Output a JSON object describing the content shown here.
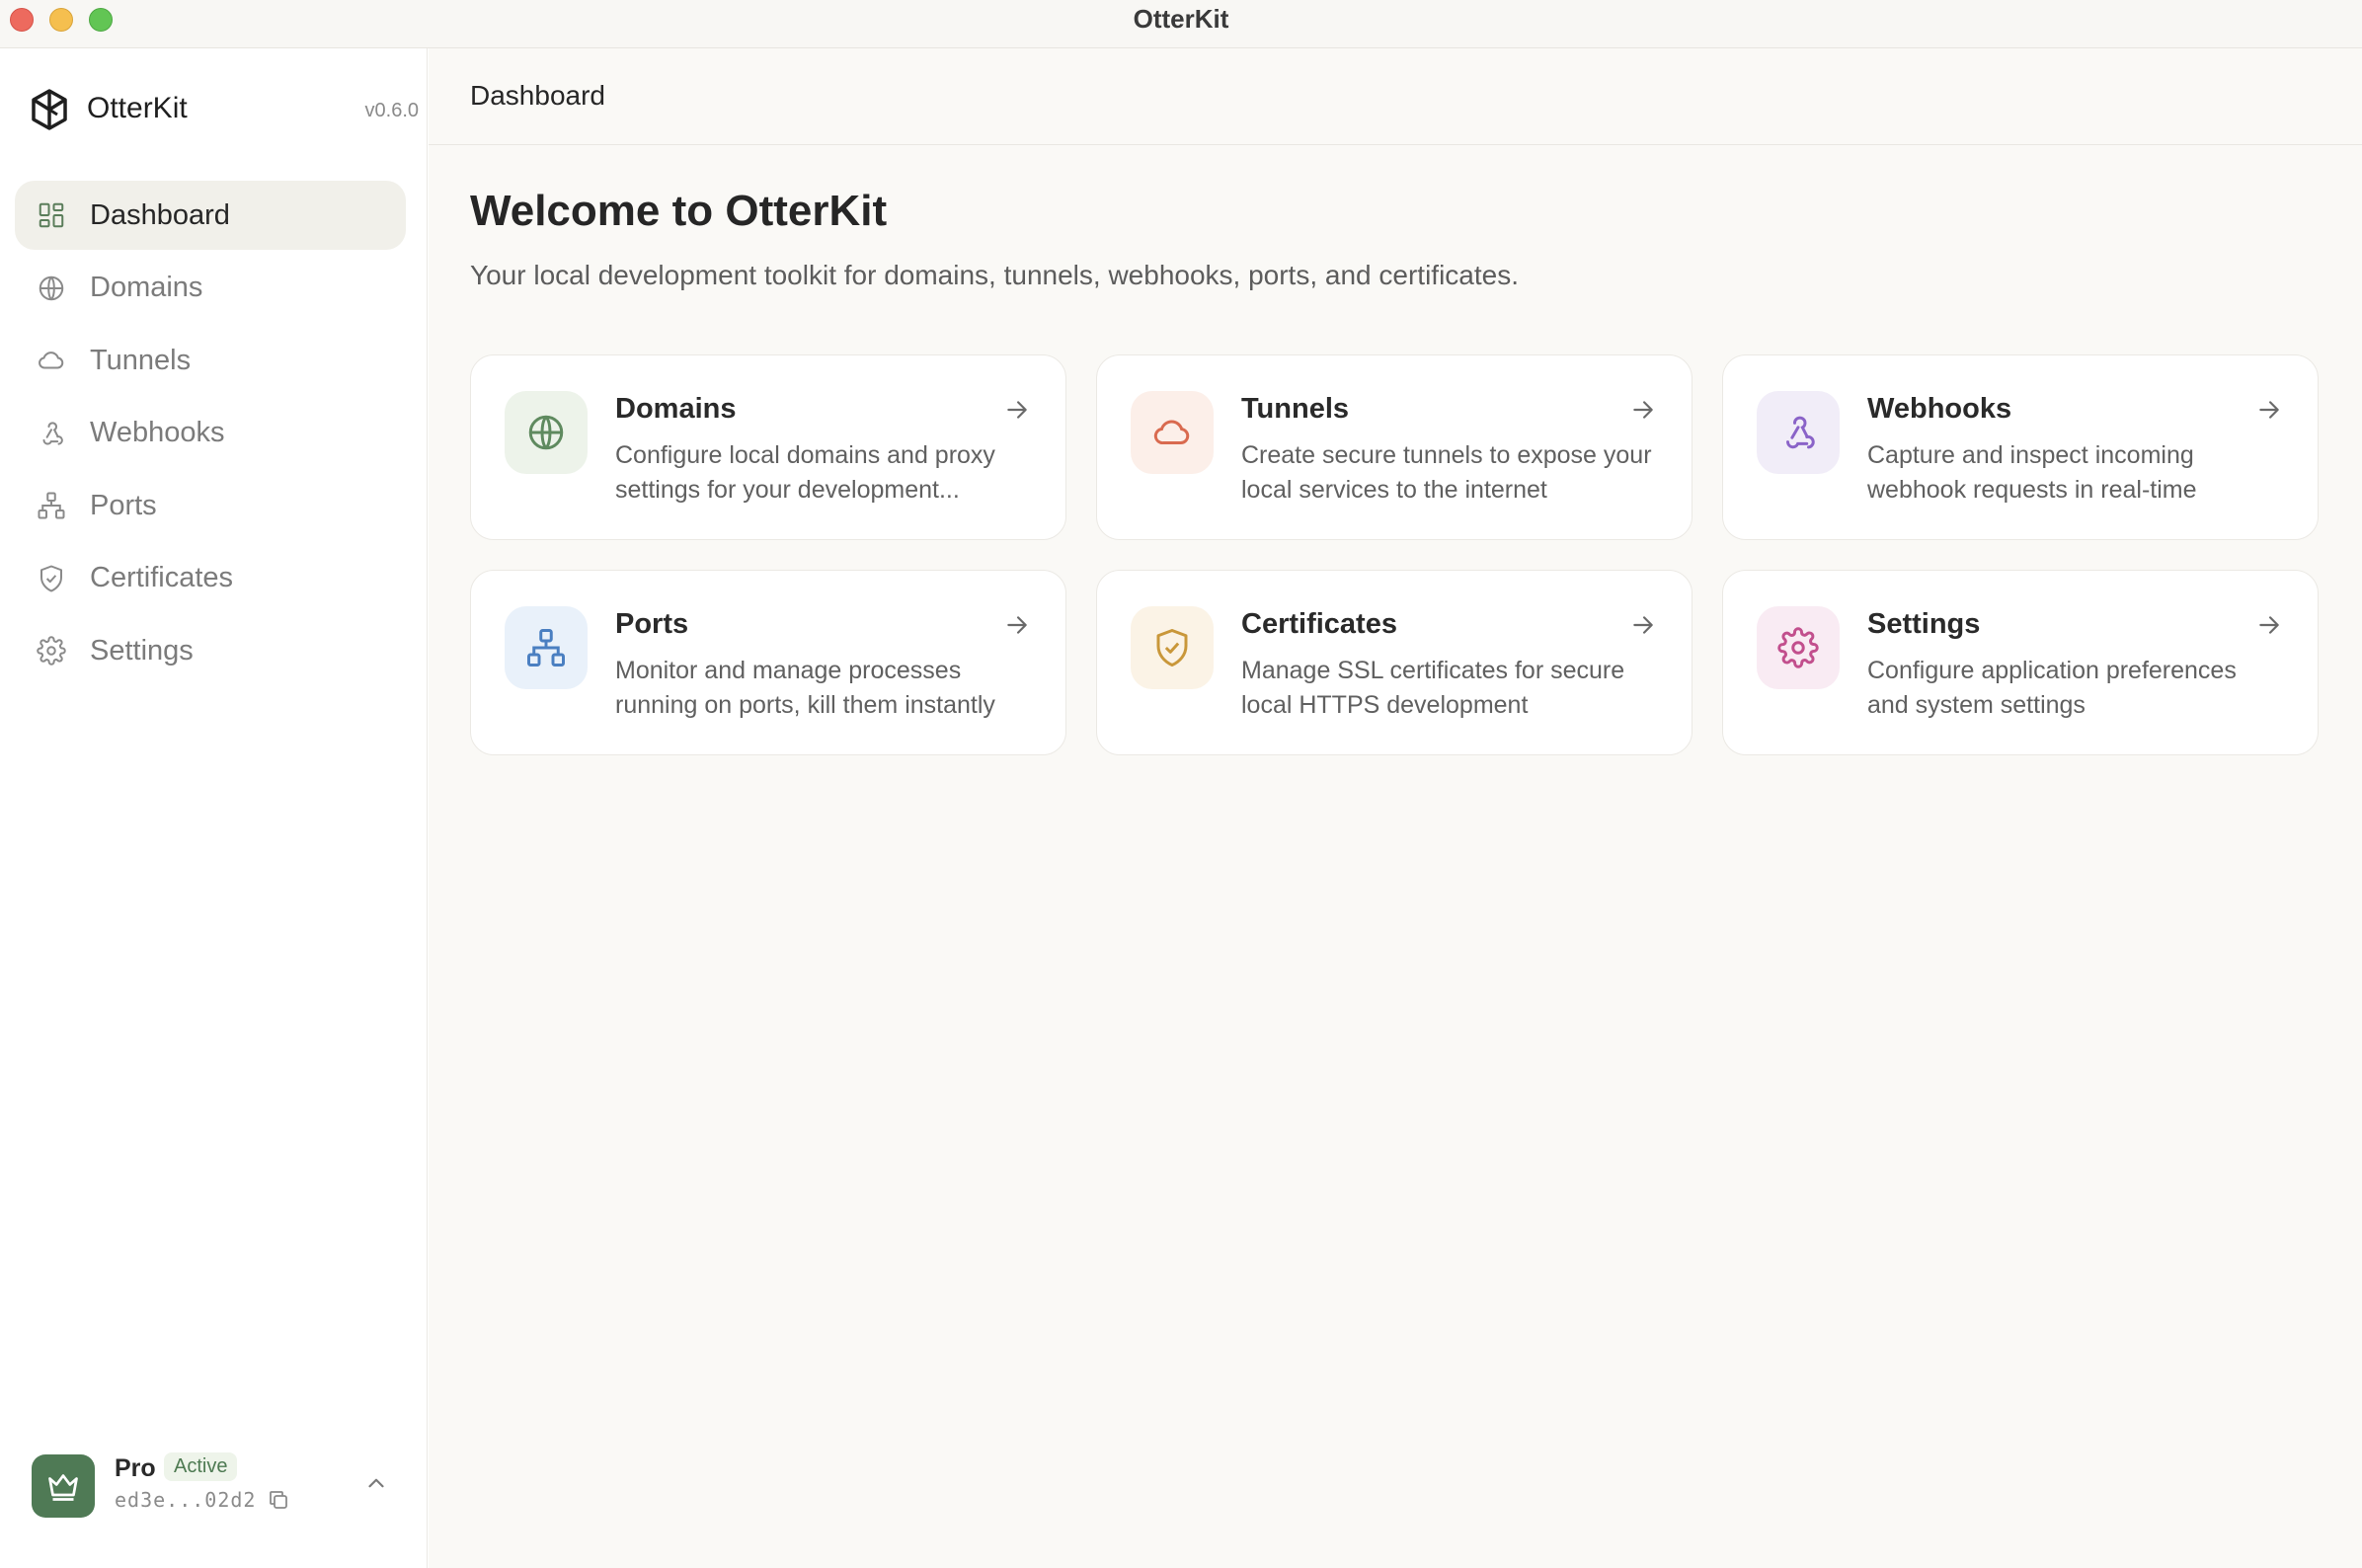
{
  "window": {
    "title": "OtterKit"
  },
  "sidebar": {
    "brand": {
      "name": "OtterKit",
      "version": "v0.6.0"
    },
    "items": [
      {
        "label": "Dashboard",
        "icon": "dashboard-icon",
        "active": true
      },
      {
        "label": "Domains",
        "icon": "globe-icon",
        "active": false
      },
      {
        "label": "Tunnels",
        "icon": "cloud-icon",
        "active": false
      },
      {
        "label": "Webhooks",
        "icon": "webhook-icon",
        "active": false
      },
      {
        "label": "Ports",
        "icon": "network-icon",
        "active": false
      },
      {
        "label": "Certificates",
        "icon": "shield-icon",
        "active": false
      },
      {
        "label": "Settings",
        "icon": "gear-icon",
        "active": false
      }
    ],
    "account": {
      "plan": "Pro",
      "status": "Active",
      "key": "ed3e...02d2"
    }
  },
  "main": {
    "header_title": "Dashboard",
    "welcome_title": "Welcome to OtterKit",
    "welcome_subtitle": "Your local development toolkit for domains, tunnels, webhooks, ports, and certificates.",
    "cards": [
      {
        "title": "Domains",
        "description": "Configure local domains and proxy settings for your development...",
        "icon": "globe-icon",
        "accent": "#5f8a5f",
        "bg": "#edf3ea"
      },
      {
        "title": "Tunnels",
        "description": "Create secure tunnels to expose your local services to the internet",
        "icon": "cloud-icon",
        "accent": "#d96a4f",
        "bg": "#fcefe9"
      },
      {
        "title": "Webhooks",
        "description": "Capture and inspect incoming webhook requests in real-time",
        "icon": "webhook-icon",
        "accent": "#8a63c8",
        "bg": "#f1edf8"
      },
      {
        "title": "Ports",
        "description": "Monitor and manage processes running on ports, kill them instantly",
        "icon": "network-icon",
        "accent": "#4a7fc1",
        "bg": "#e9f1fa"
      },
      {
        "title": "Certificates",
        "description": "Manage SSL certificates for secure local HTTPS development",
        "icon": "shield-icon",
        "accent": "#c9973a",
        "bg": "#fbf3e6"
      },
      {
        "title": "Settings",
        "description": "Configure application preferences and system settings",
        "icon": "gear-icon",
        "accent": "#c24f8d",
        "bg": "#f9ebf3"
      }
    ]
  },
  "colors": {
    "accent_green": "#4f7a55",
    "sidebar_active_bg": "#f1f0ea",
    "main_bg": "#faf9f6"
  }
}
